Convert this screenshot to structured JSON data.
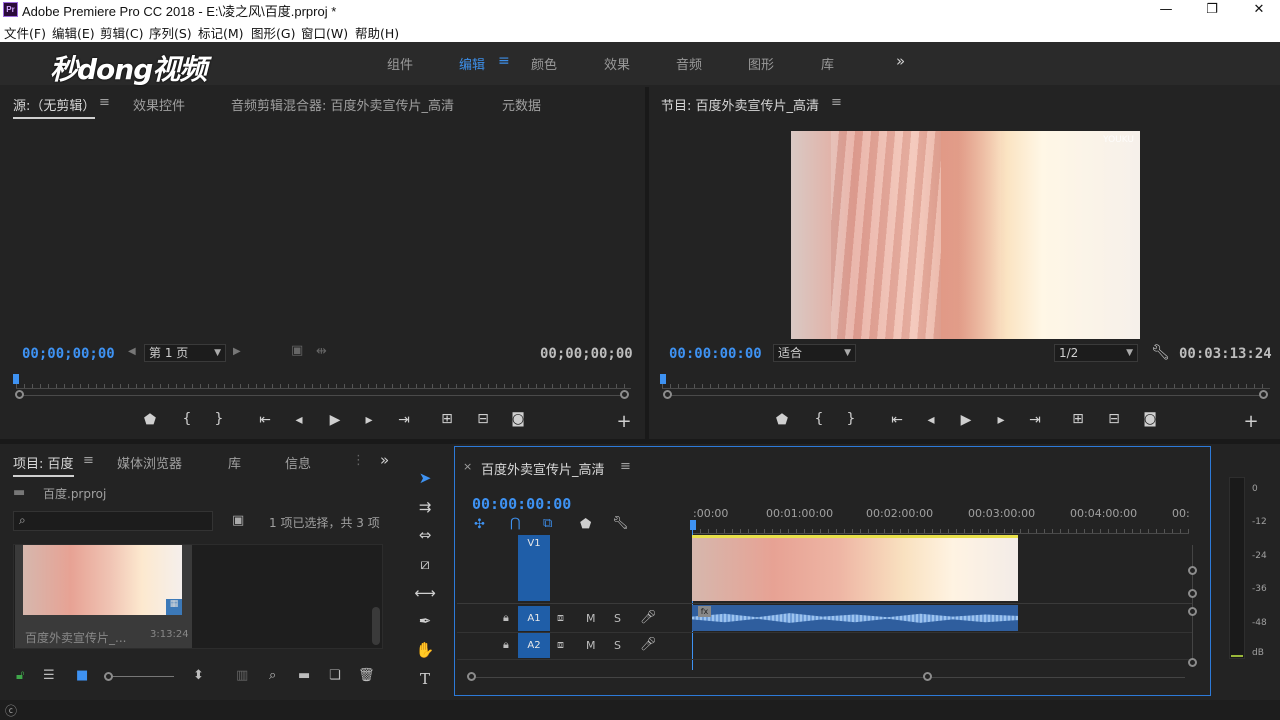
{
  "window": {
    "title": "Adobe Premiere Pro CC 2018 - E:\\凌之风\\百度.prproj *",
    "app_icon": "Pr",
    "controls": {
      "minimize": "—",
      "restore": "❐",
      "close": "✕"
    }
  },
  "menu": [
    "文件(F)",
    "编辑(E)",
    "剪辑(C)",
    "序列(S)",
    "标记(M)",
    "图形(G)",
    "窗口(W)",
    "帮助(H)"
  ],
  "workspace": {
    "watermark_logo": "秒dong视频",
    "tabs": [
      "组件",
      "编辑",
      "颜色",
      "效果",
      "音频",
      "图形",
      "库"
    ],
    "active_tab": "编辑",
    "overflow": "»"
  },
  "source_panel": {
    "tabs": [
      "源:（无剪辑）",
      "效果控件",
      "音频剪辑混合器: 百度外卖宣传片_高清",
      "元数据"
    ],
    "timecode_in": "00;00;00;00",
    "page_select": "第 1 页",
    "timecode_out": "00;00;00;00"
  },
  "program_panel": {
    "title": "节目: 百度外卖宣传片_高清",
    "timecode": "00:00:00:00",
    "fit_select": "适合",
    "resolution_select": "1/2",
    "duration": "00:03:13:24",
    "frame_watermark": "YOUKU"
  },
  "project_panel": {
    "tabs": [
      "项目: 百度",
      "媒体浏览器",
      "库",
      "信息"
    ],
    "file": "百度.prproj",
    "search_placeholder": "",
    "selection_status": "1 项已选择，共 3 项",
    "item": {
      "name": "百度外卖宣传片_...",
      "duration": "3:13:24"
    }
  },
  "timeline": {
    "sequence_name": "百度外卖宣传片_高清",
    "timecode": "00:00:00:00",
    "ruler": [
      ":00:00",
      "00:01:00:00",
      "00:02:00:00",
      "00:03:00:00",
      "00:04:00:00",
      "00:"
    ],
    "tracks": {
      "video": [
        {
          "label": "V1"
        }
      ],
      "audio": [
        {
          "label": "A1",
          "mute": "M",
          "solo": "S"
        },
        {
          "label": "A2",
          "mute": "M",
          "solo": "S"
        }
      ]
    },
    "audio_clip_badge": "fx"
  },
  "audio_meter": {
    "labels": [
      "0",
      "-12",
      "-24",
      "-36",
      "-48",
      "dB"
    ]
  },
  "colors": {
    "accent": "#3e92f2",
    "track_label": "#1f5ea8",
    "video_clip_bar": "#e8e04a",
    "audio_clip": "#2f5e9e"
  }
}
